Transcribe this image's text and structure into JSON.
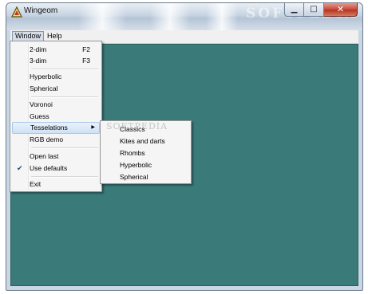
{
  "window": {
    "title": "Wingeom",
    "title_watermark": "SOFTPEDIA",
    "controls": {
      "minimize_icon": "minimize-icon",
      "maximize_icon": "maximize-icon",
      "close_icon": "close-icon"
    }
  },
  "menubar": {
    "items": [
      {
        "label": "Window",
        "active": true
      },
      {
        "label": "Help",
        "active": false
      }
    ]
  },
  "window_menu": {
    "items": [
      {
        "label": "2-dim",
        "shortcut": "F2"
      },
      {
        "label": "3-dim",
        "shortcut": "F3"
      },
      {
        "label": "Hyperbolic"
      },
      {
        "label": "Spherical"
      },
      {
        "label": "Voronoi"
      },
      {
        "label": "Guess"
      },
      {
        "label": "Tesselations",
        "has_submenu": true,
        "highlighted": true
      },
      {
        "label": "RGB demo"
      },
      {
        "label": "Open last"
      },
      {
        "label": "Use defaults",
        "checked": true
      },
      {
        "label": "Exit"
      }
    ]
  },
  "tesselations_submenu": {
    "items": [
      {
        "label": "Classics"
      },
      {
        "label": "Kites and darts"
      },
      {
        "label": "Rhombs"
      },
      {
        "label": "Hyperbolic"
      },
      {
        "label": "Spherical"
      }
    ]
  },
  "watermark": "SOFTPEDIA",
  "colors": {
    "client_background": "#3a7a79",
    "menu_background": "#f5f5f5",
    "highlight": "#cfe1f5"
  }
}
